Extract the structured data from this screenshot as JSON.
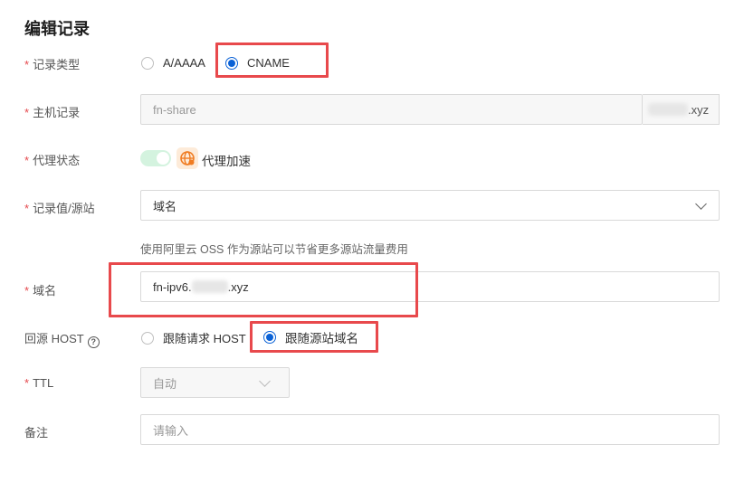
{
  "title": "编辑记录",
  "required_mark": "*",
  "record_type": {
    "label": "记录类型",
    "options": [
      "A/AAAA",
      "CNAME"
    ],
    "selected": "CNAME"
  },
  "host_record": {
    "label": "主机记录",
    "value": "fn-share",
    "suffix": ".xyz"
  },
  "proxy_status": {
    "label": "代理状态",
    "text": "代理加速",
    "enabled": true
  },
  "record_value": {
    "label": "记录值/源站",
    "selected": "域名",
    "hint": "使用阿里云 OSS 作为源站可以节省更多源站流量费用"
  },
  "domain": {
    "label": "域名",
    "value_prefix": "fn-ipv6.",
    "value_suffix": ".xyz"
  },
  "origin_host": {
    "label": "回源 HOST",
    "help": "?",
    "options": [
      "跟随请求 HOST",
      "跟随源站域名"
    ],
    "selected": "跟随源站域名"
  },
  "ttl": {
    "label": "TTL",
    "selected": "自动"
  },
  "remark": {
    "label": "备注",
    "placeholder": "请输入"
  },
  "colors": {
    "accent": "#0b62d6",
    "highlight": "#e8494c",
    "required": "#e5484d",
    "toggle_on": "#d4f3df",
    "globe": "#f07c22"
  }
}
